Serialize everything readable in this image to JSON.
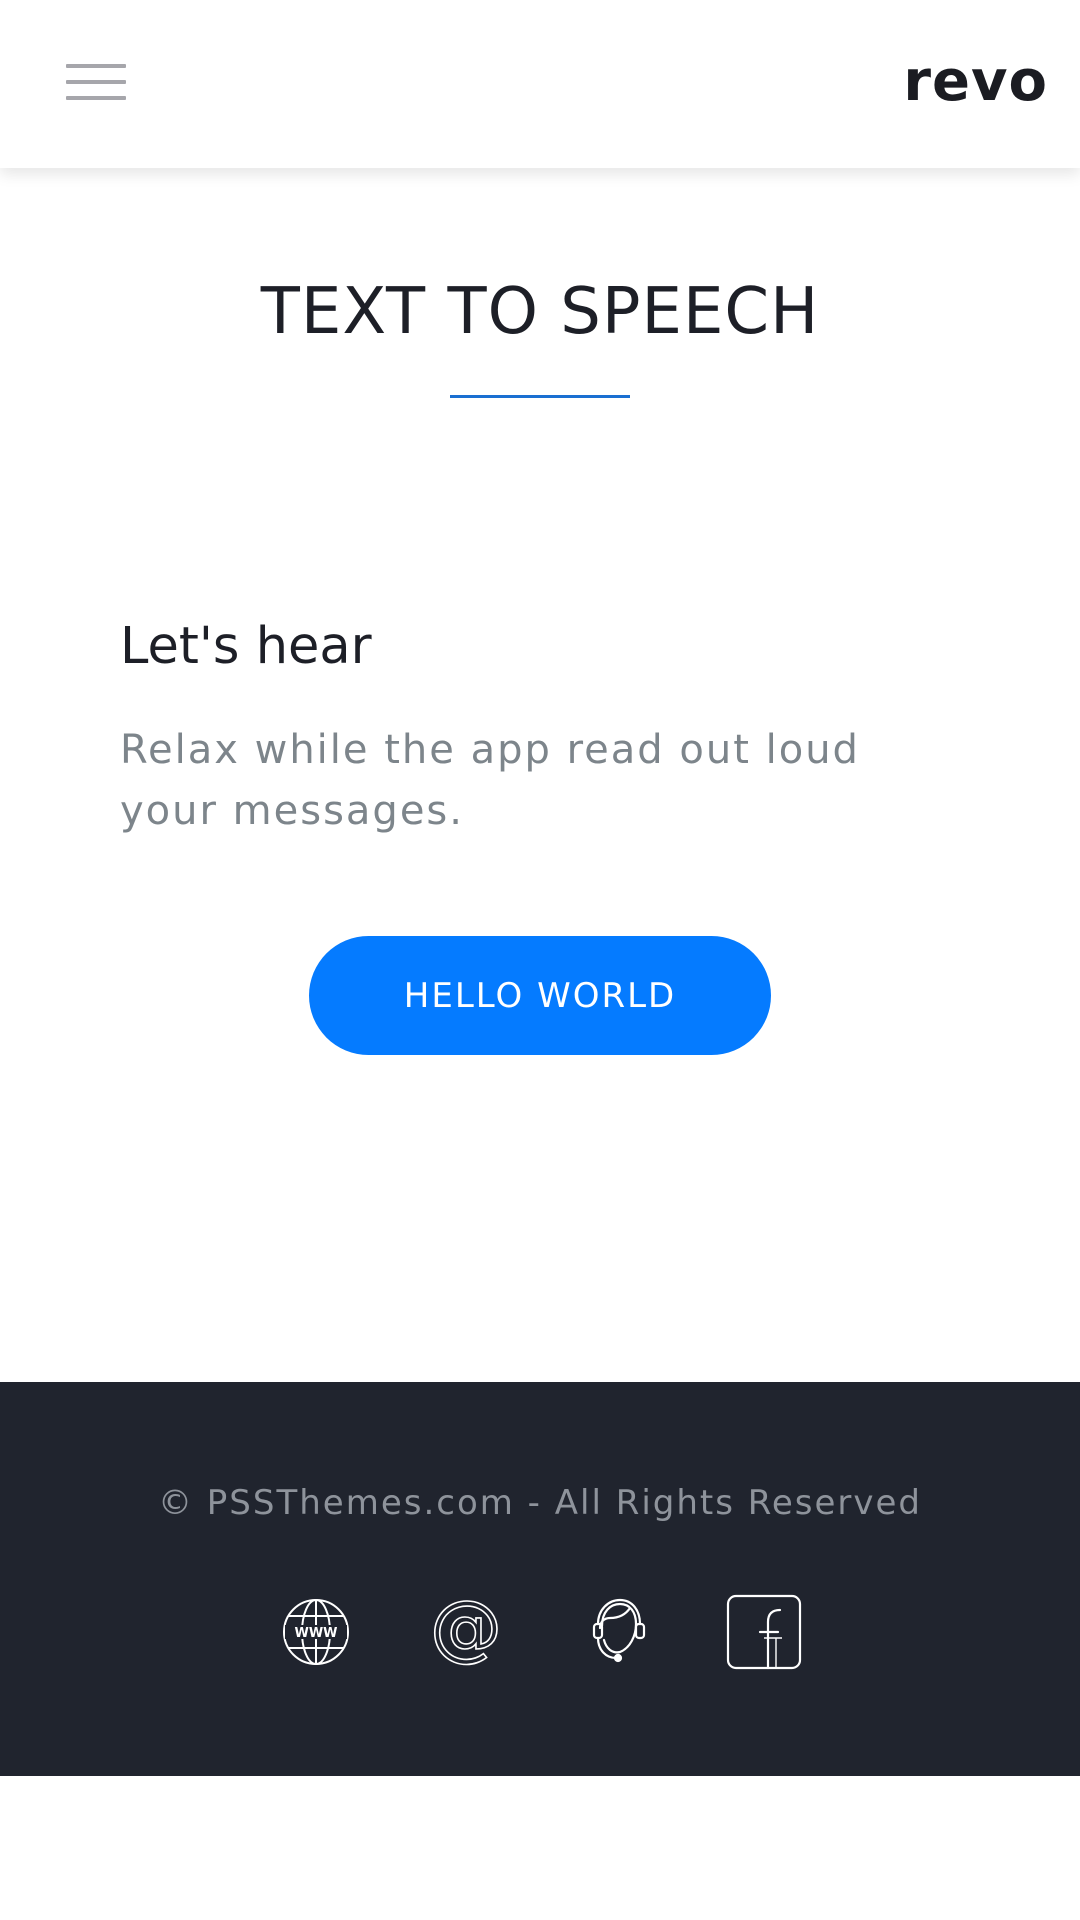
{
  "header": {
    "brand": "revo"
  },
  "main": {
    "title": "TEXT TO SPEECH",
    "heading": "Let's hear",
    "description": "Relax while the app read out loud your messages.",
    "button_label": "HELLO WORLD"
  },
  "footer": {
    "copyright": "© PSSThemes.com - All Rights Reserved",
    "social_icons": [
      "globe-www-icon",
      "at-sign-icon",
      "support-headset-icon",
      "facebook-icon"
    ]
  },
  "colors": {
    "accent": "#057bff",
    "underline": "#1a6fd1",
    "footer_bg": "#20242e",
    "heading_text": "#1d1f27",
    "muted_text": "#7d858b"
  }
}
